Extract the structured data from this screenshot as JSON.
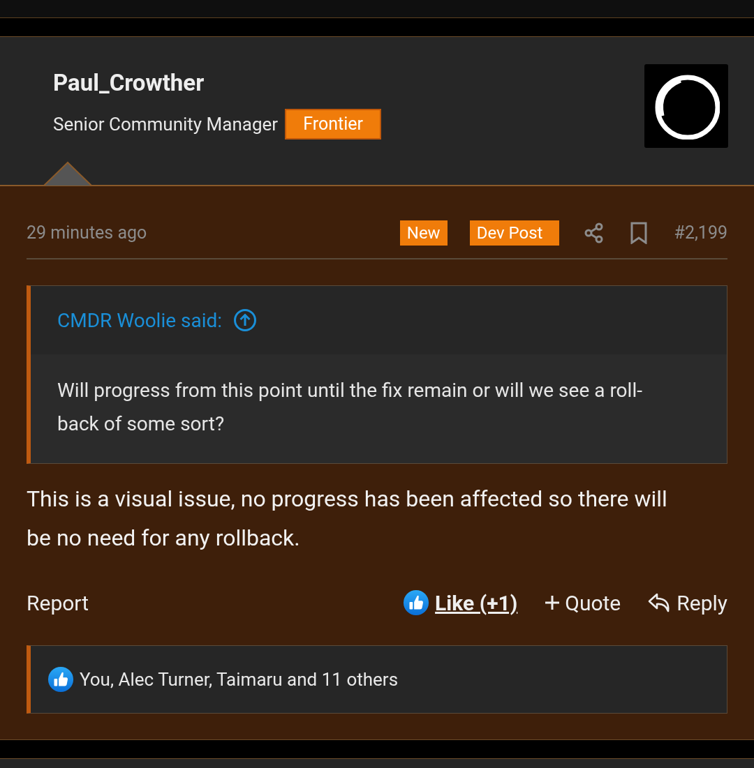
{
  "author": {
    "name": "Paul_Crowther",
    "title": "Senior Community Manager",
    "badge": "Frontier"
  },
  "post": {
    "time": "29 minutes ago",
    "tags": [
      "New",
      "Dev Post"
    ],
    "number": "#2,199",
    "quote": {
      "attribution": "CMDR Woolie said:",
      "text": "Will progress from this point until the fix remain or will we see a roll-back of some sort?"
    },
    "message": "This is a visual issue, no progress has been affected so there will be no need for any rollback.",
    "actions": {
      "report": "Report",
      "like": "Like (+1)",
      "quote": "Quote",
      "reply": "Reply"
    },
    "reactions": "You, Alec Turner, Taimaru and 11 others"
  }
}
